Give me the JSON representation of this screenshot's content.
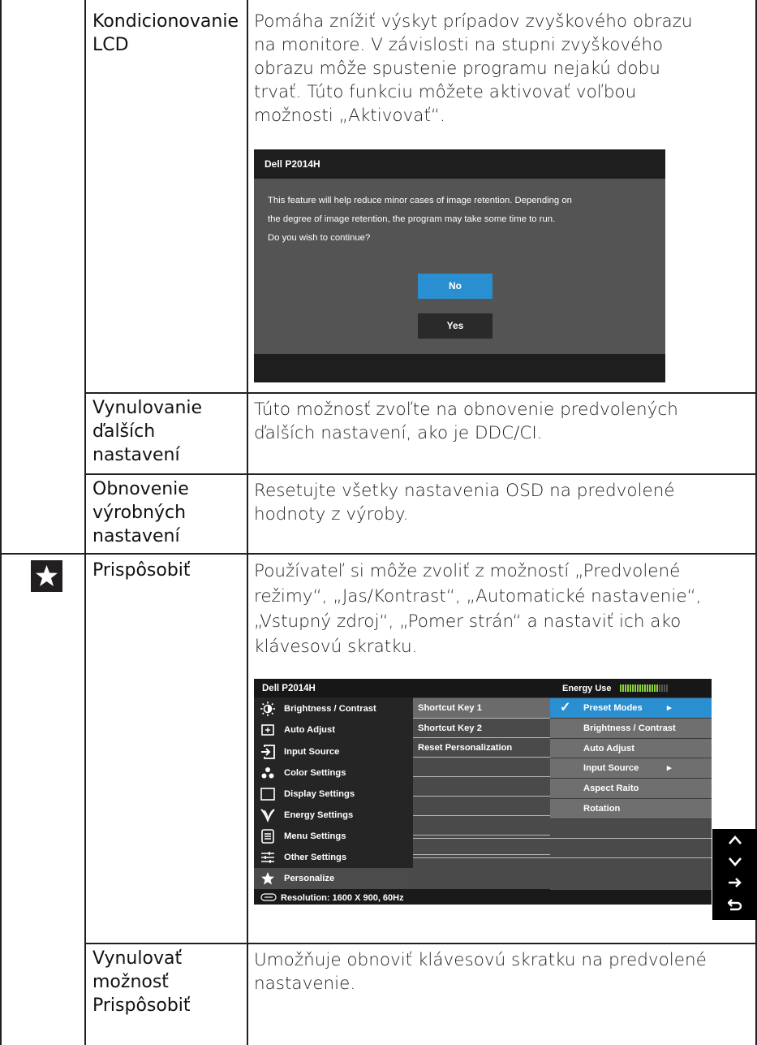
{
  "rows": [
    {
      "label": [
        "Kondicionovanie",
        "LCD"
      ],
      "desc": [
        "Pomáha znížiť výskyt prípadov zvyškového obrazu",
        "na monitore. V závislosti na stupni zvyškového",
        "obrazu môže spustenie programu nejakú dobu",
        "trvať. Túto funkciu môžete aktivovať voľbou",
        "možnosti „Aktivovať“."
      ]
    },
    {
      "label": [
        "Vynulovanie",
        "ďalších",
        "nastavení"
      ],
      "desc": [
        "Túto možnosť zvoľte na obnovenie predvolených",
        "ďalších nastavení, ako je DDC/CI."
      ]
    },
    {
      "label": [
        "Obnovenie",
        "výrobných",
        "nastavení"
      ],
      "desc": [
        "Resetujte všetky nastavenia OSD na predvolené",
        "hodnoty z výroby."
      ]
    },
    {
      "label": [
        "Prispôsobiť"
      ],
      "desc": [
        "Používateľ si môže zvoliť z možností „Predvolené",
        "režimy“, „Jas/Kontrast“, „Automatické nastavenie“,",
        "„Vstupný zdroj“, „Pomer strán“ a nastaviť ich ako",
        "klávesovú skratku."
      ]
    },
    {
      "label": [
        "Vynulovať",
        "možnosť",
        "Prispôsobiť"
      ],
      "desc": [
        "Umožňuje obnoviť klávesovú skratku na predvolené",
        "nastavenie."
      ]
    }
  ],
  "dialog": {
    "title": "Dell P2014H",
    "message": [
      "This feature will help reduce minor cases of image retention. Depending on",
      "the degree of image retention, the program may take some time to run.",
      "Do you wish to continue?"
    ],
    "no_label": "No",
    "yes_label": "Yes",
    "no_color": "#2a8fd0",
    "yes_color": "#2a2a2a"
  },
  "osd": {
    "model": "Dell P2014H",
    "energy_label": "Energy Use",
    "energy_level": 0.8,
    "menu": [
      {
        "label": "Brightness / Contrast",
        "icon": "brightness-icon"
      },
      {
        "label": "Auto Adjust",
        "icon": "auto-adjust-icon"
      },
      {
        "label": "Input Source",
        "icon": "input-source-icon"
      },
      {
        "label": "Color Settings",
        "icon": "color-settings-icon"
      },
      {
        "label": "Display Settings",
        "icon": "display-settings-icon"
      },
      {
        "label": "Energy Settings",
        "icon": "energy-settings-icon"
      },
      {
        "label": "Menu Settings",
        "icon": "menu-settings-icon"
      },
      {
        "label": "Other Settings",
        "icon": "other-settings-icon"
      },
      {
        "label": "Personalize",
        "icon": "star-icon"
      }
    ],
    "middle": [
      "Shortcut Key 1",
      "Shortcut Key 2",
      "Reset Personalization"
    ],
    "options": [
      "Preset Modes",
      "Brightness / Contrast",
      "Auto Adjust",
      "Input Source",
      "Aspect Raito",
      "Rotation"
    ],
    "resolution": "Resolution:  1600 X 900, 60Hz",
    "accent": "#2a8fd0"
  },
  "nav_buttons": [
    "up-arrow-icon",
    "down-arrow-icon",
    "right-arrow-icon",
    "back-icon"
  ]
}
